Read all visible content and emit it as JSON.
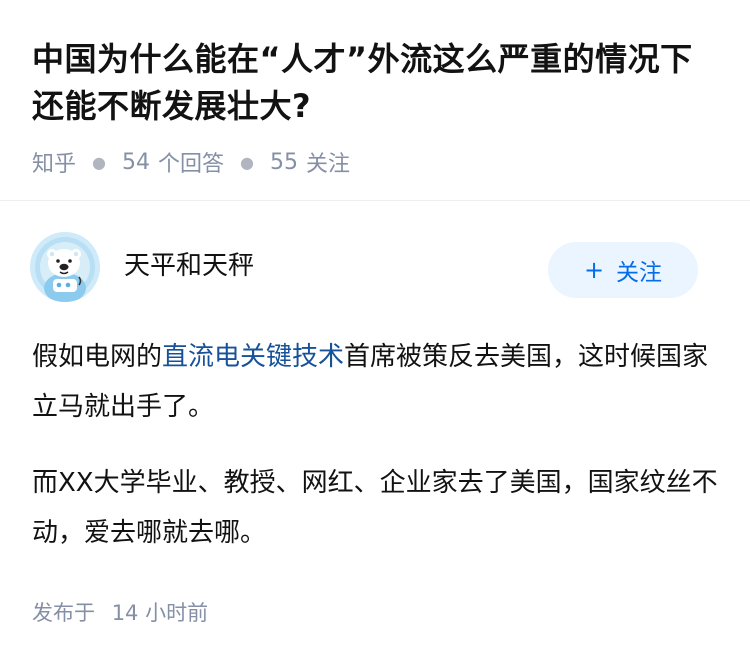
{
  "question": {
    "title": "中国为什么能在“人才”外流这么严重的情况下还能不断发展壮大?",
    "source": "知乎",
    "answer_count": "54",
    "answer_label": "个回答",
    "follower_count": "55",
    "follower_label": "关注"
  },
  "answer": {
    "author_name": "天平和天秤",
    "follow_button": {
      "plus": "+",
      "label": "关注"
    },
    "paragraphs": [
      {
        "before_link": "假如电网的",
        "link_text": "直流电关键技术",
        "after_link": "首席被策反去美国，这时候国家立马就出手了。"
      },
      {
        "text": "而XX大学毕业、教授、网红、企业家去了美国，国家纹丝不动，爱去哪就去哪。"
      }
    ],
    "time_prefix": "发布于",
    "time_value": "14 小时前"
  },
  "colors": {
    "link": "#175199",
    "follow_text": "#056de8",
    "follow_bg": "#ebf5ff",
    "meta_gray": "#8590a6",
    "avatar_bg": "#dff1fb"
  },
  "icons": {
    "avatar": "polar-bear-astronaut-avatar-icon",
    "meta_separator": "dot-separator"
  }
}
